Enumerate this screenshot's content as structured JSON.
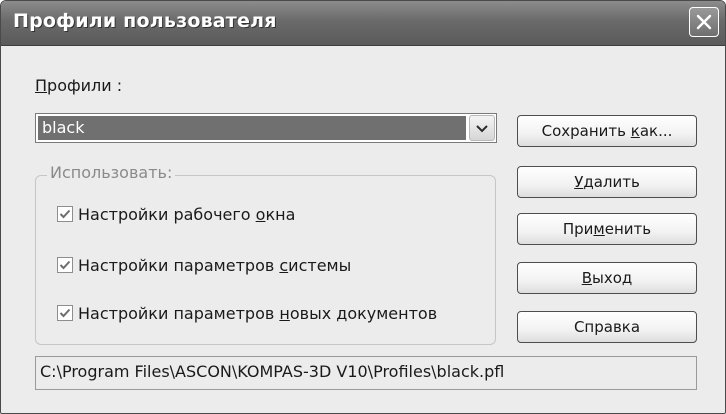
{
  "window": {
    "title": "Профили пользователя"
  },
  "profiles": {
    "label": "Профили :",
    "selected": "black"
  },
  "use_group": {
    "legend": "Использовать:",
    "options": [
      {
        "label": "Настройки рабочего окна",
        "checked": true
      },
      {
        "label": "Настройки параметров системы",
        "checked": true
      },
      {
        "label": "Настройки параметров новых документов",
        "checked": true
      }
    ]
  },
  "buttons": {
    "save_as": "Сохранить как...",
    "delete": "Удалить",
    "apply": "Применить",
    "exit": "Выход",
    "help": "Справка"
  },
  "profile_path": "C:\\Program Files\\ASCON\\KOMPAS-3D V10\\Profiles\\black.pfl",
  "icons": {
    "close": "close-icon",
    "dropdown": "chevron-down-icon",
    "check": "checkmark-icon"
  }
}
